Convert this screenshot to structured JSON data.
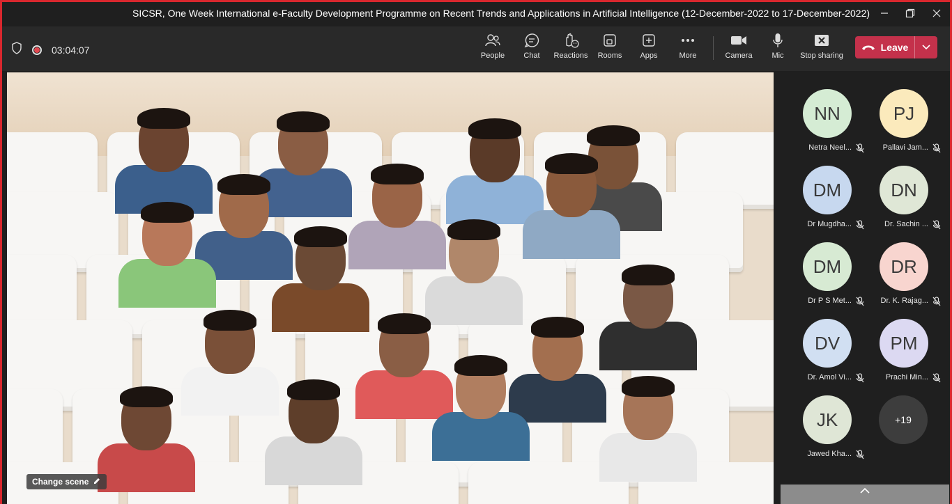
{
  "window": {
    "title": "SICSR, One Week International e-Faculty Development Programme on Recent Trends and Applications in Artificial Intelligence (12-December-2022 to 17-December-2022)"
  },
  "toolbar": {
    "timer": "03:04:07",
    "buttons": [
      {
        "label": "People",
        "icon": "people-icon"
      },
      {
        "label": "Chat",
        "icon": "chat-icon"
      },
      {
        "label": "Reactions",
        "icon": "reactions-icon"
      },
      {
        "label": "Rooms",
        "icon": "rooms-icon"
      },
      {
        "label": "Apps",
        "icon": "apps-icon"
      },
      {
        "label": "More",
        "icon": "more-icon"
      },
      {
        "label": "Camera",
        "icon": "camera-icon"
      },
      {
        "label": "Mic",
        "icon": "mic-icon"
      },
      {
        "label": "Stop sharing",
        "icon": "stop-sharing-icon"
      }
    ],
    "leave_label": "Leave",
    "leave_color": "#c4314b"
  },
  "stage": {
    "change_scene_label": "Change scene"
  },
  "participants": [
    {
      "initials": "NN",
      "name": "Netra Neel...",
      "color": "#d5ecd4"
    },
    {
      "initials": "PJ",
      "name": "Pallavi Jam...",
      "color": "#fbeabc"
    },
    {
      "initials": "DM",
      "name": "Dr Mugdha...",
      "color": "#c7d8ef"
    },
    {
      "initials": "DN",
      "name": "Dr. Sachin ...",
      "color": "#dfe7d6"
    },
    {
      "initials": "DM",
      "name": "Dr P S Met...",
      "color": "#d7ead3"
    },
    {
      "initials": "DR",
      "name": "Dr. K. Rajag...",
      "color": "#f8d5cf"
    },
    {
      "initials": "DV",
      "name": "Dr. Amol Vi...",
      "color": "#d1dff2"
    },
    {
      "initials": "PM",
      "name": "Prachi Min...",
      "color": "#dcd9f2"
    },
    {
      "initials": "JK",
      "name": "Jawed Kha...",
      "color": "#dfe6d6"
    }
  ],
  "overflow_count": "+19"
}
